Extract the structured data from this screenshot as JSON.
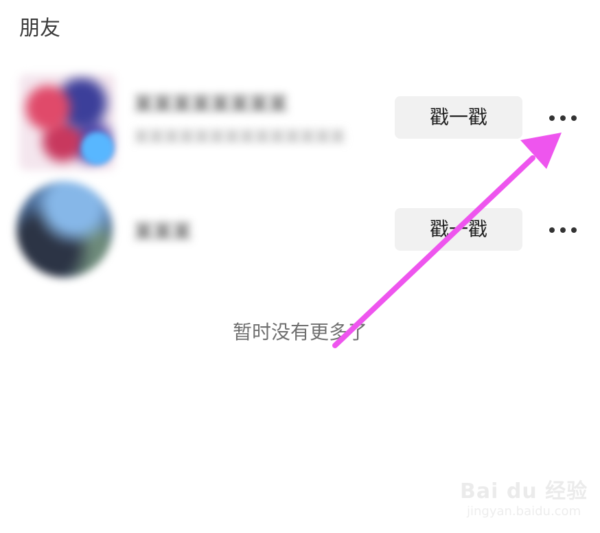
{
  "section": {
    "title": "朋友"
  },
  "friends": [
    {
      "name": "某某某某某某某某",
      "subtitle": "某某某某某某某某某某某某某某",
      "poke_label": "戳一戳",
      "more_icon": "more-icon"
    },
    {
      "name": "某某某",
      "poke_label": "戳一戳",
      "more_icon": "more-icon"
    }
  ],
  "empty_hint": "暂时没有更多了",
  "annotation": {
    "arrow_color": "#ee55ee"
  },
  "watermark": {
    "logo": "Bai du 经验",
    "site": "jingyan.baidu.com"
  }
}
